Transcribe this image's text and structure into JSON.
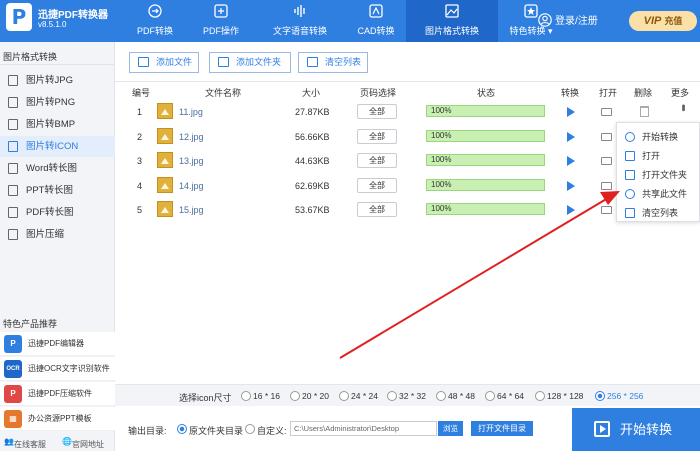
{
  "app": {
    "logo_letter": "P",
    "title": "迅捷PDF转换器",
    "version": "v8.5.1.0"
  },
  "nav": [
    {
      "label": "PDF转换",
      "icon": "pdf-convert-icon"
    },
    {
      "label": "PDF操作",
      "icon": "pdf-operate-icon"
    },
    {
      "label": "文字语音转换",
      "icon": "voice-icon"
    },
    {
      "label": "CAD转换",
      "icon": "cad-icon"
    },
    {
      "label": "图片格式转换",
      "icon": "image-icon",
      "active": true
    },
    {
      "label": "特色转换 ▾",
      "icon": "star-icon"
    }
  ],
  "user": {
    "login_label": "登录/注册",
    "vip_badge": "VIP",
    "vip_label": "充值"
  },
  "sidebar": {
    "title": "图片格式转换",
    "items": [
      {
        "label": "图片转JPG"
      },
      {
        "label": "图片转PNG"
      },
      {
        "label": "图片转BMP"
      },
      {
        "label": "图片转ICON",
        "active": true
      },
      {
        "label": "Word转长图"
      },
      {
        "label": "PPT转长图"
      },
      {
        "label": "PDF转长图"
      },
      {
        "label": "图片压缩"
      }
    ],
    "products_title": "特色产品推荐",
    "products": [
      {
        "label": "迅捷PDF编辑器",
        "icon_text": "P",
        "color": "#2f7fe0"
      },
      {
        "label": "迅捷OCR文字识别软件",
        "icon_text": "OCR",
        "color": "#1f68c9"
      },
      {
        "label": "迅捷PDF压缩软件",
        "icon_text": "P",
        "color": "#e04848"
      },
      {
        "label": "办公资源PPT模板",
        "icon_text": "▦",
        "color": "#e5782e"
      }
    ],
    "footer": {
      "service": "在线客服",
      "website": "官网地址"
    }
  },
  "toolbar": {
    "add_file": "添加文件",
    "add_folder": "添加文件夹",
    "clear_list": "清空列表"
  },
  "table": {
    "headers": {
      "num": "编号",
      "name": "文件名称",
      "size": "大小",
      "pages": "页码选择",
      "status": "状态",
      "convert": "转换",
      "open": "打开",
      "delete": "删除",
      "more": "更多"
    },
    "rows": [
      {
        "num": "1",
        "name": "11.jpg",
        "size": "27.87KB",
        "pages": "全部",
        "status": "100%",
        "progress": 1.0
      },
      {
        "num": "2",
        "name": "12.jpg",
        "size": "56.66KB",
        "pages": "全部",
        "status": "100%",
        "progress": 1.0
      },
      {
        "num": "3",
        "name": "13.jpg",
        "size": "44.63KB",
        "pages": "全部",
        "status": "100%",
        "progress": 1.0
      },
      {
        "num": "4",
        "name": "14.jpg",
        "size": "62.69KB",
        "pages": "全部",
        "status": "100%",
        "progress": 1.0
      },
      {
        "num": "5",
        "name": "15.jpg",
        "size": "53.67KB",
        "pages": "全部",
        "status": "100%",
        "progress": 1.0
      }
    ]
  },
  "context_menu": [
    {
      "label": "开始转换",
      "icon": "play-circle-icon"
    },
    {
      "label": "打开",
      "icon": "file-icon"
    },
    {
      "label": "打开文件夹",
      "icon": "folder-icon"
    },
    {
      "label": "共享此文件",
      "icon": "share-icon"
    },
    {
      "label": "清空列表",
      "icon": "trash-icon"
    }
  ],
  "icon_size": {
    "label": "选择icon尺寸",
    "options": [
      "16 * 16",
      "20 * 20",
      "24 * 24",
      "32 * 32",
      "48 * 48",
      "64 * 64",
      "128 * 128",
      "256 * 256"
    ],
    "selected": "256 * 256"
  },
  "output": {
    "label": "输出目录:",
    "opt_source": "原文件夹目录",
    "opt_custom": "自定义:",
    "selected": "原文件夹目录",
    "path": "C:\\Users\\Administrator\\Desktop",
    "browse": "浏览",
    "open_output": "打开文件目录",
    "start": "开始转换"
  },
  "colors": {
    "brand": "#2f7fe0",
    "progress": "#c8f0b2",
    "arrow": "#e02020"
  }
}
